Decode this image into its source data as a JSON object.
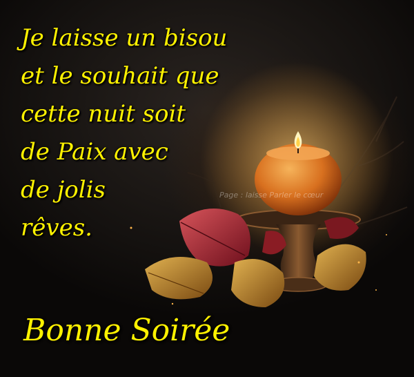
{
  "message": {
    "lines": [
      "Je laisse un bisou",
      "et le souhait que",
      "cette nuit soit",
      "de Paix avec",
      "de jolis",
      "rêves."
    ]
  },
  "greeting": "Bonne Soirée",
  "watermark": "Page : laisse Parler le cœur",
  "colors": {
    "text": "#fff200",
    "background": "#14110f",
    "candle": "#e07a25",
    "leaf_red": "#9e1f2a",
    "leaf_gold": "#b8862a"
  },
  "icons": {
    "candle": "candle-icon",
    "flame": "flame-icon",
    "leaves": "autumn-leaves-icon"
  }
}
